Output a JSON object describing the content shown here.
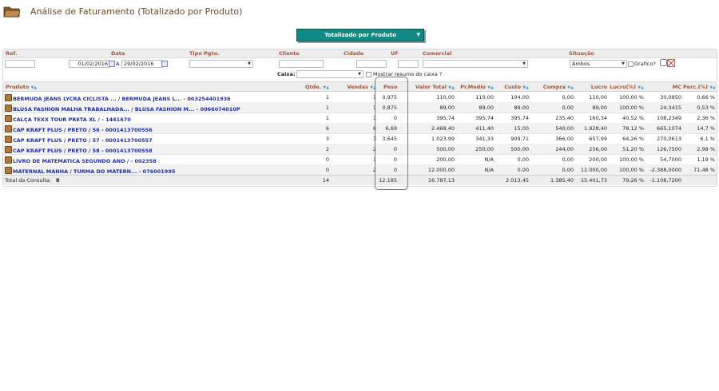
{
  "page": {
    "title": "Análise de Faturamento (Totalizado por Produto)",
    "mode_select": "Totalizado por Produto"
  },
  "filters": {
    "labels": {
      "ref": "Ref.",
      "data": "Data",
      "tipo_pgto": "Tipo Pgto.",
      "cliente": "Cliente",
      "cidade": "Cidade",
      "uf": "UF",
      "comercial": "Comercial",
      "situacao": "Situação"
    },
    "ref": "",
    "date_from": "01/02/2016",
    "date_sep": "A",
    "date_to": "29/02/2016",
    "tipo_pgto": "",
    "cliente": "",
    "cidade": "",
    "uf": "",
    "comercial": "",
    "situacao": "Ambos",
    "grafico_label": "Grafico?",
    "caixa_label": "Caixa:",
    "caixa": "",
    "mostrar_resumo_label": "Mostrar resumo do caixa ?"
  },
  "table": {
    "headers": {
      "produto": "Produto",
      "qtde": "Qtde.",
      "vendas": "Vendas",
      "peso": "Peso",
      "valor_total": "Valor Total",
      "pr_medio": "Pr.Medio",
      "custo": "Custo",
      "compra": "Compra",
      "lucro": "Lucro",
      "lucro_pct": "Lucro(%)",
      "mc": "MC",
      "perc": "Perc.(%)"
    },
    "rows": [
      {
        "produto": "BERMUDA JEANS LYCRA CICLISTA ... / BERMUDA JEANS L... - 003254401936",
        "qtde": "1",
        "vendas": "1",
        "peso": "0,975",
        "valor_total": "110,00",
        "pr_medio": "110,00",
        "custo": "104,00",
        "compra": "0,00",
        "lucro": "110,00",
        "lucro_pct": "100,00 %",
        "mc": "30,0850",
        "perc": "0,66 %"
      },
      {
        "produto": "BLUSA FASHION MALHA TRABALHADA... / BLUSA FASHION M... - 0066074010P",
        "qtde": "1",
        "vendas": "1",
        "peso": "0,875",
        "valor_total": "89,00",
        "pr_medio": "89,00",
        "custo": "89,00",
        "compra": "0,00",
        "lucro": "89,00",
        "lucro_pct": "100,00 %",
        "mc": "24,3415",
        "perc": "0,53 %"
      },
      {
        "produto": "CALÇA TEXX TOUR PRETA XL / - 1441670",
        "qtde": "1",
        "vendas": "1",
        "peso": "0",
        "valor_total": "395,74",
        "pr_medio": "395,74",
        "custo": "395,74",
        "compra": "235,40",
        "lucro": "160,34",
        "lucro_pct": "40,52 %",
        "mc": "108,2349",
        "perc": "2,36 %"
      },
      {
        "produto": "CAP KRAFT PLUS / PRETO / 56 - 0001413700556",
        "qtde": "6",
        "vendas": "8",
        "peso": "6,69",
        "valor_total": "2.468,40",
        "pr_medio": "411,40",
        "custo": "15,00",
        "compra": "540,00",
        "lucro": "1.928,40",
        "lucro_pct": "78,12 %",
        "mc": "665,1074",
        "perc": "14,7 %"
      },
      {
        "produto": "CAP KRAFT PLUS / PRETO / 57 - 0001413700557",
        "qtde": "3",
        "vendas": "3",
        "peso": "3,645",
        "valor_total": "1.023,99",
        "pr_medio": "341,33",
        "custo": "909,71",
        "compra": "366,00",
        "lucro": "657,99",
        "lucro_pct": "64,26 %",
        "mc": "270,0613",
        "perc": "6,1 %"
      },
      {
        "produto": "CAP KRAFT PLUS / PRETO / 58 - 0001413700558",
        "qtde": "2",
        "vendas": "2",
        "peso": "0",
        "valor_total": "500,00",
        "pr_medio": "250,00",
        "custo": "500,00",
        "compra": "244,00",
        "lucro": "256,00",
        "lucro_pct": "51,20 %",
        "mc": "126,7500",
        "perc": "2,98 %"
      },
      {
        "produto": "LIVRO DE MATEMATICA SEGUNDO ANO / - 002358",
        "qtde": "0",
        "vendas": "1",
        "peso": "0",
        "valor_total": "200,00",
        "pr_medio": "N/A",
        "custo": "0,00",
        "compra": "0,00",
        "lucro": "200,00",
        "lucro_pct": "100,00 %",
        "mc": "54,7000",
        "perc": "1,19 %"
      },
      {
        "produto": "MATERNAL MANHA / TURMA DO MATERN... - 076001995",
        "qtde": "0",
        "vendas": "2",
        "peso": "0",
        "valor_total": "12.000,00",
        "pr_medio": "N/A",
        "custo": "0,00",
        "compra": "0,00",
        "lucro": "12.000,00",
        "lucro_pct": "100,00 %",
        "mc": "-2.388,0000",
        "perc": "71,48 %"
      }
    ],
    "total": {
      "label": "Total da Consulta:",
      "count": "8",
      "qtde": "14",
      "peso": "12,185",
      "valor_total": "16.787,13",
      "custo": "2.013,45",
      "compra": "1.385,40",
      "lucro": "15.401,73",
      "lucro_pct": "79,26 %",
      "mc": "-1.108,7200"
    }
  },
  "colors": {
    "header_label": "#a2543a",
    "product_link": "#1b2fa8",
    "mode_button": "#0f8a84"
  }
}
